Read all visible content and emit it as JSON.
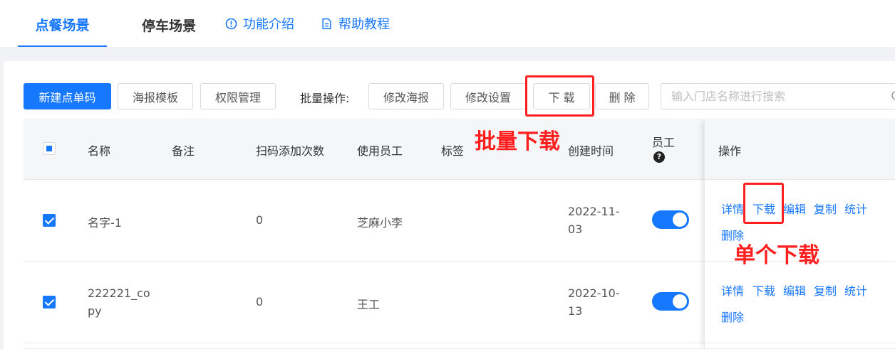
{
  "tabs": {
    "dining": "点餐场景",
    "parking": "停车场景",
    "intro": "功能介绍",
    "help": "帮助教程"
  },
  "toolbar": {
    "new_button": "新建点单码",
    "poster_template": "海报模板",
    "permission": "权限管理",
    "batch_label": "批量操作:",
    "edit_poster": "修改海报",
    "edit_settings": "修改设置",
    "download": "下 载",
    "delete": "删 除",
    "search_placeholder": "输入门店名称进行搜索"
  },
  "table": {
    "headers": {
      "name": "名称",
      "remark": "备注",
      "scan_count": "扫码添加次数",
      "staff": "使用员工",
      "tag": "标签",
      "created": "创建时间",
      "employee": "员工",
      "actions": "操作"
    },
    "rows": [
      {
        "name": "名字-1",
        "scan_count": "0",
        "staff": "芝麻小李",
        "created_line1": "2022-11-",
        "created_line2": "03",
        "checked": true,
        "employee_enabled": true
      },
      {
        "name_line1": "222221_co",
        "name_line2": "py",
        "scan_count": "0",
        "staff": "王工",
        "created_line1": "2022-10-",
        "created_line2": "13",
        "checked": true,
        "employee_enabled": true
      }
    ],
    "row_actions": {
      "detail": "详情",
      "download": "下载",
      "edit": "编辑",
      "copy": "复制",
      "stats": "统计",
      "delete": "删除"
    }
  },
  "annotations": {
    "batch_download": "批量下载",
    "single_download": "单个下载"
  },
  "colors": {
    "accent": "#1677ff",
    "annotation_red": "#ff1f1f"
  }
}
